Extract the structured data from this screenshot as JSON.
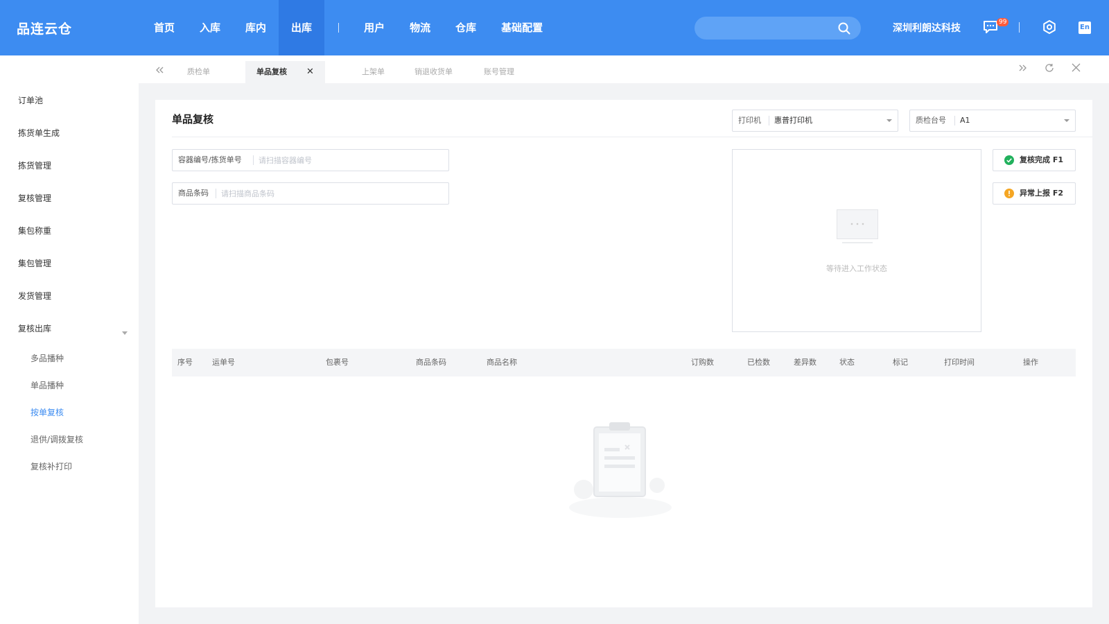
{
  "app": {
    "title": "品连云仓"
  },
  "nav": {
    "items": [
      "首页",
      "入库",
      "库内",
      "出库"
    ],
    "items2": [
      "用户",
      "物流",
      "仓库",
      "基础配置"
    ],
    "active": "出库"
  },
  "header": {
    "company": "深圳利朗达科技",
    "badge_count": "99",
    "lang": "En",
    "accent_color": "#3d8cf1"
  },
  "sidebar": {
    "items": [
      "订单池",
      "拣货单生成",
      "拣货管理",
      "复核管理",
      "集包称重",
      "集包管理",
      "发货管理",
      "复核出库"
    ],
    "sub_items": [
      "多品播种",
      "单品播种",
      "按单复核",
      "退供/调拨复核",
      "复核补打印"
    ],
    "active_sub": "按单复核"
  },
  "tabs": {
    "items": [
      "质检单",
      "单品复核",
      "上架单",
      "销退收货单",
      "账号管理"
    ],
    "active": "单品复核"
  },
  "main": {
    "title": "单品复核",
    "printer": {
      "label": "打印机",
      "value": "惠普打印机"
    },
    "station": {
      "label": "质检台号",
      "value": "A1"
    },
    "container": {
      "label": "容器编号/拣货单号",
      "placeholder": "请扫描容器编号"
    },
    "barcode": {
      "label": "商品条码",
      "placeholder": "请扫描商品条码"
    },
    "wait_text": "等待进入工作状态",
    "buttons": {
      "complete": "复核完成 F1",
      "exception": "异常上报 F2"
    },
    "table": {
      "columns": [
        "序号",
        "运单号",
        "包裹号",
        "商品条码",
        "商品名称",
        "订购数",
        "已检数",
        "差异数",
        "状态",
        "标记",
        "打印时间",
        "操作"
      ],
      "rows": []
    }
  }
}
